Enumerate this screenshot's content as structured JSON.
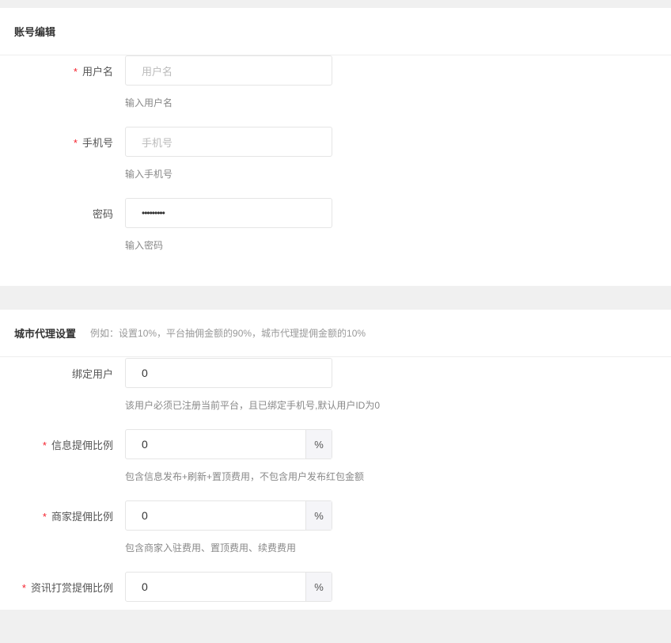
{
  "account": {
    "title": "账号编辑",
    "fields": [
      {
        "label": "用户名",
        "required": true,
        "placeholder": "用户名",
        "value": "",
        "help": "输入用户名"
      },
      {
        "label": "手机号",
        "required": true,
        "placeholder": "手机号",
        "value": "",
        "help": "输入手机号"
      },
      {
        "label": "密码",
        "required": false,
        "placeholder": "",
        "value": "•••••••••",
        "help": "输入密码"
      }
    ]
  },
  "agent": {
    "title": "城市代理设置",
    "subtitle": "例如：设置10%，平台抽佣金额的90%，城市代理提佣金额的10%",
    "fields": [
      {
        "label": "绑定用户",
        "required": false,
        "value": "0",
        "help": "该用户必须已注册当前平台，且已绑定手机号,默认用户ID为0"
      },
      {
        "label": "信息提佣比例",
        "required": true,
        "value": "0",
        "suffix": "%",
        "help": "包含信息发布+刷新+置顶费用，不包含用户发布红包金额"
      },
      {
        "label": "商家提佣比例",
        "required": true,
        "value": "0",
        "suffix": "%",
        "help": "包含商家入驻费用、置顶费用、续费费用"
      },
      {
        "label": "资讯打赏提佣比例",
        "required": true,
        "value": "0",
        "suffix": "%"
      }
    ]
  },
  "required_mark": "*"
}
